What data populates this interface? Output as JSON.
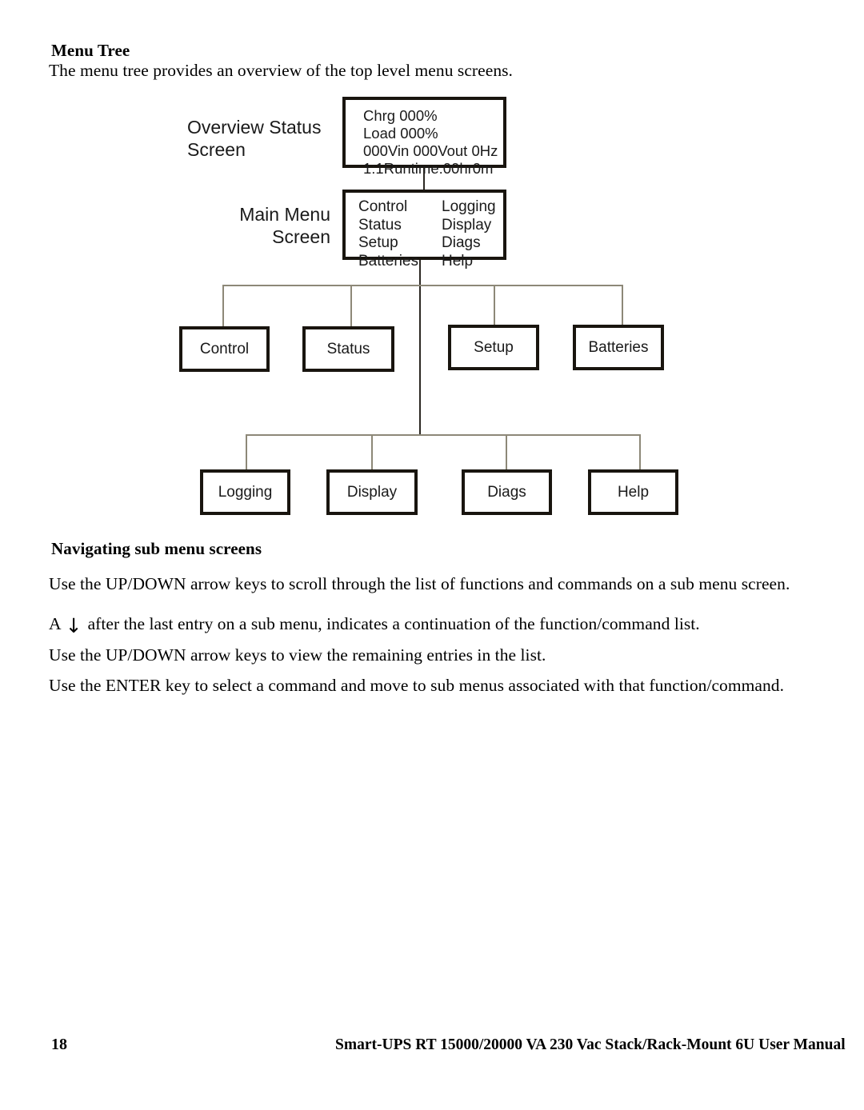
{
  "section": {
    "heading": "Menu Tree",
    "intro": "The menu tree provides an overview of the top level menu screens."
  },
  "diagram": {
    "overview_label_line1": "Overview Status",
    "overview_label_line2": "Screen",
    "main_menu_label_line1": "Main Menu",
    "main_menu_label_line2": "Screen",
    "overview_screen": {
      "line1": "Chrg 000%",
      "line2": "Load 000%",
      "line3": "000Vin 000Vout 0Hz",
      "line4": "1:1Runtime:00hr0m"
    },
    "main_menu": {
      "left_column": [
        "Control",
        "Status",
        "Setup",
        "Batteries"
      ],
      "right_column": [
        "Logging",
        "Display",
        "Diags",
        "Help"
      ]
    },
    "row1_boxes": [
      "Control",
      "Status",
      "Setup",
      "Batteries"
    ],
    "row2_boxes": [
      "Logging",
      "Display",
      "Diags",
      "Help"
    ]
  },
  "navigating": {
    "heading": "Navigating sub menu screens",
    "p1": "Use the UP/DOWN arrow keys to scroll through the list of functions and commands on a sub menu screen.",
    "p2_before": "A",
    "p2_arrow": "↓",
    "p2_after": "after the last entry on a sub menu, indicates a continuation of the function/command list.",
    "p3": "Use the UP/DOWN arrow keys to view the remaining entries in the list.",
    "p4": "Use the ENTER key to select a command and move to sub menus associated with that function/command."
  },
  "footer": {
    "page_number": "18",
    "title": "Smart-UPS RT 15000/20000 VA  230 Vac  Stack/Rack-Mount 6U  User Manual"
  }
}
